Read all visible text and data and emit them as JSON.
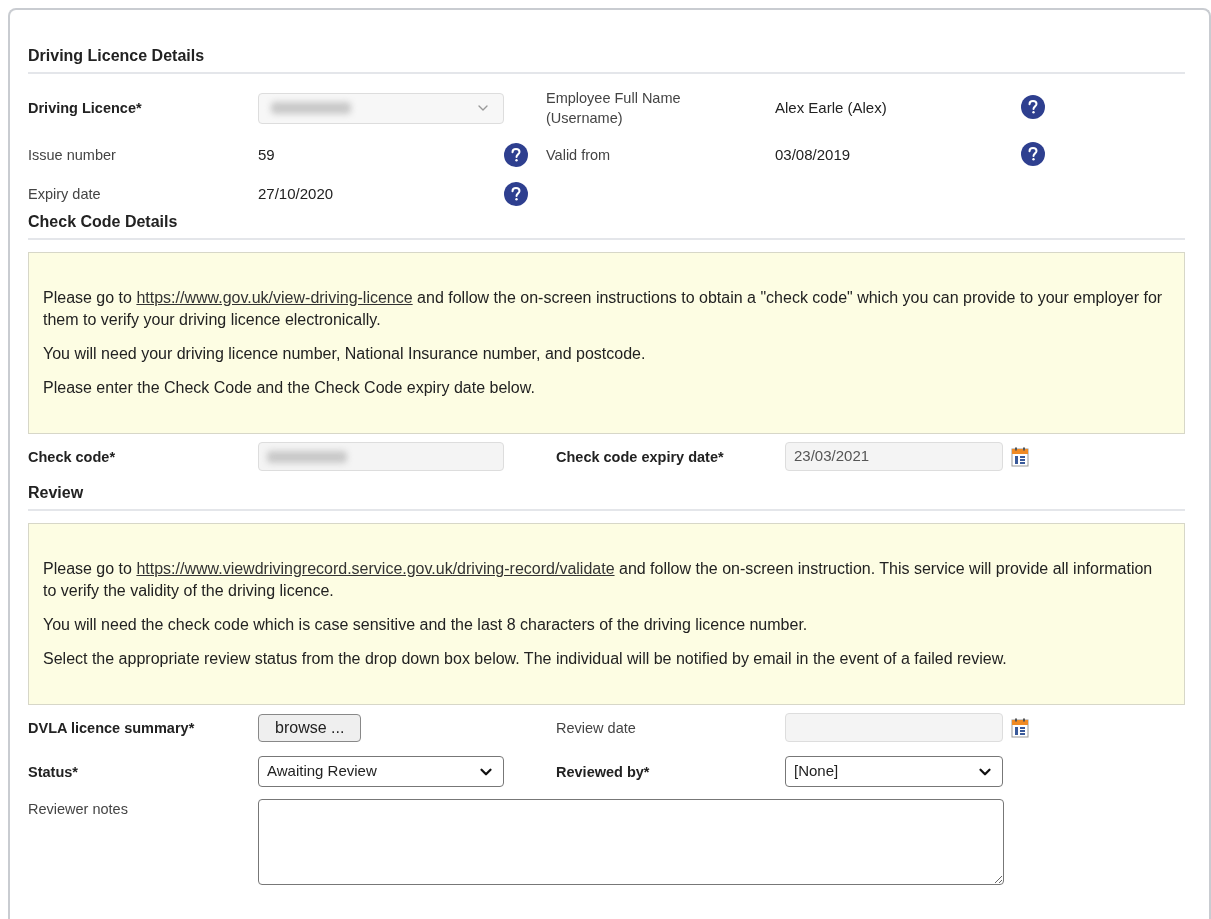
{
  "sections": [
    {
      "title": "Driving Licence Details"
    },
    {
      "title": "Check Code Details"
    },
    {
      "title": "Review"
    }
  ],
  "licence_rows": [
    {
      "left": {
        "label": "Driving Licence*",
        "required": true,
        "kind": "select",
        "help": false
      },
      "right": {
        "label": "Employee Full Name (Username)",
        "required": false,
        "value": "Alex Earle (Alex)",
        "help": true
      }
    },
    {
      "left": {
        "label": "Issue number",
        "required": false,
        "kind": "text",
        "value": "59",
        "help": true
      },
      "right": {
        "label": "Valid from",
        "required": false,
        "value": "03/08/2019",
        "help": true
      }
    },
    {
      "left": {
        "label": "Expiry date",
        "required": false,
        "kind": "text",
        "value": "27/10/2020",
        "help": true
      }
    }
  ],
  "check_info": {
    "paragraphs": [
      {
        "before": "Please go to ",
        "link": "https://www.gov.uk/view-driving-licence",
        "after": " and follow the on-screen instructions to obtain a \"check code\" which you can provide to your employer for them to verify your driving licence electronically."
      },
      {
        "text": "You will need your driving licence number, National Insurance number, and postcode."
      },
      {
        "text": "Please enter the Check Code and the Check Code expiry date below."
      }
    ]
  },
  "check_fields": {
    "code_label": "Check code*",
    "expiry_label": "Check code expiry date*",
    "expiry_value": "23/03/2021"
  },
  "review_info": {
    "paragraphs": [
      {
        "before": "Please go to ",
        "link": "https://www.viewdrivingrecord.service.gov.uk/driving-record/validate",
        "after": " and follow the on-screen instruction. This service will provide all information to verify the validity of the driving licence."
      },
      {
        "text": "You will need the check code which is case sensitive and the last 8 characters of the driving licence number."
      },
      {
        "text": "Select the appropriate review status from the drop down box below. The individual will be notified by email in the event of a failed review."
      }
    ]
  },
  "review_fields": {
    "summary_label": "DVLA licence summary*",
    "browse_button": "browse ...",
    "review_date_label": "Review date",
    "status_label": "Status*",
    "status_value": "Awaiting Review",
    "reviewed_by_label": "Reviewed by*",
    "reviewed_by_value": "[None]",
    "notes_label": "Reviewer notes"
  }
}
